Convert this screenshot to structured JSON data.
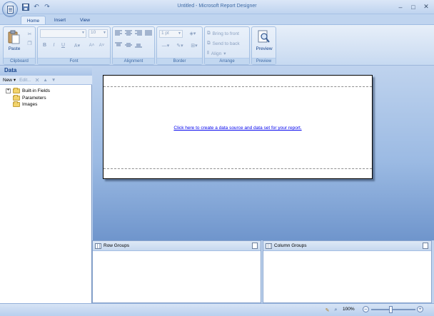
{
  "window": {
    "title": "Untitled - Microsoft Report Designer"
  },
  "quick_access": {
    "save_icon": "save-icon",
    "undo_icon": "undo-icon",
    "redo_icon": "redo-icon"
  },
  "tabs": [
    {
      "label": "Home",
      "active": true
    },
    {
      "label": "Insert",
      "active": false
    },
    {
      "label": "View",
      "active": false
    }
  ],
  "ribbon": {
    "clipboard": {
      "label": "Clipboard",
      "paste": "Paste"
    },
    "font": {
      "label": "Font",
      "size": "10"
    },
    "alignment": {
      "label": "Alignment"
    },
    "border": {
      "label": "Border",
      "width": "1 pt"
    },
    "arrange": {
      "label": "Arrange",
      "bring_to_front": "Bring to front",
      "send_to_back": "Send to back",
      "align": "Align"
    },
    "preview": {
      "label": "Preview",
      "button": "Preview"
    }
  },
  "data_pane": {
    "title": "Data",
    "new": "New",
    "edit": "Edit...",
    "items": [
      {
        "label": "Built-in Fields",
        "expandable": true
      },
      {
        "label": "Parameters",
        "expandable": false
      },
      {
        "label": "Images",
        "expandable": false
      }
    ]
  },
  "report": {
    "link": "Click here to create a data source and data set for your report."
  },
  "groups": {
    "row": "Row Groups",
    "column": "Column Groups"
  },
  "status": {
    "zoom": "100%",
    "zoom_level": 100
  },
  "colors": {
    "accent": "#15428b",
    "surface_top": "#bfd3ee",
    "surface_bottom": "#6f95cc",
    "link": "#0000ee"
  }
}
